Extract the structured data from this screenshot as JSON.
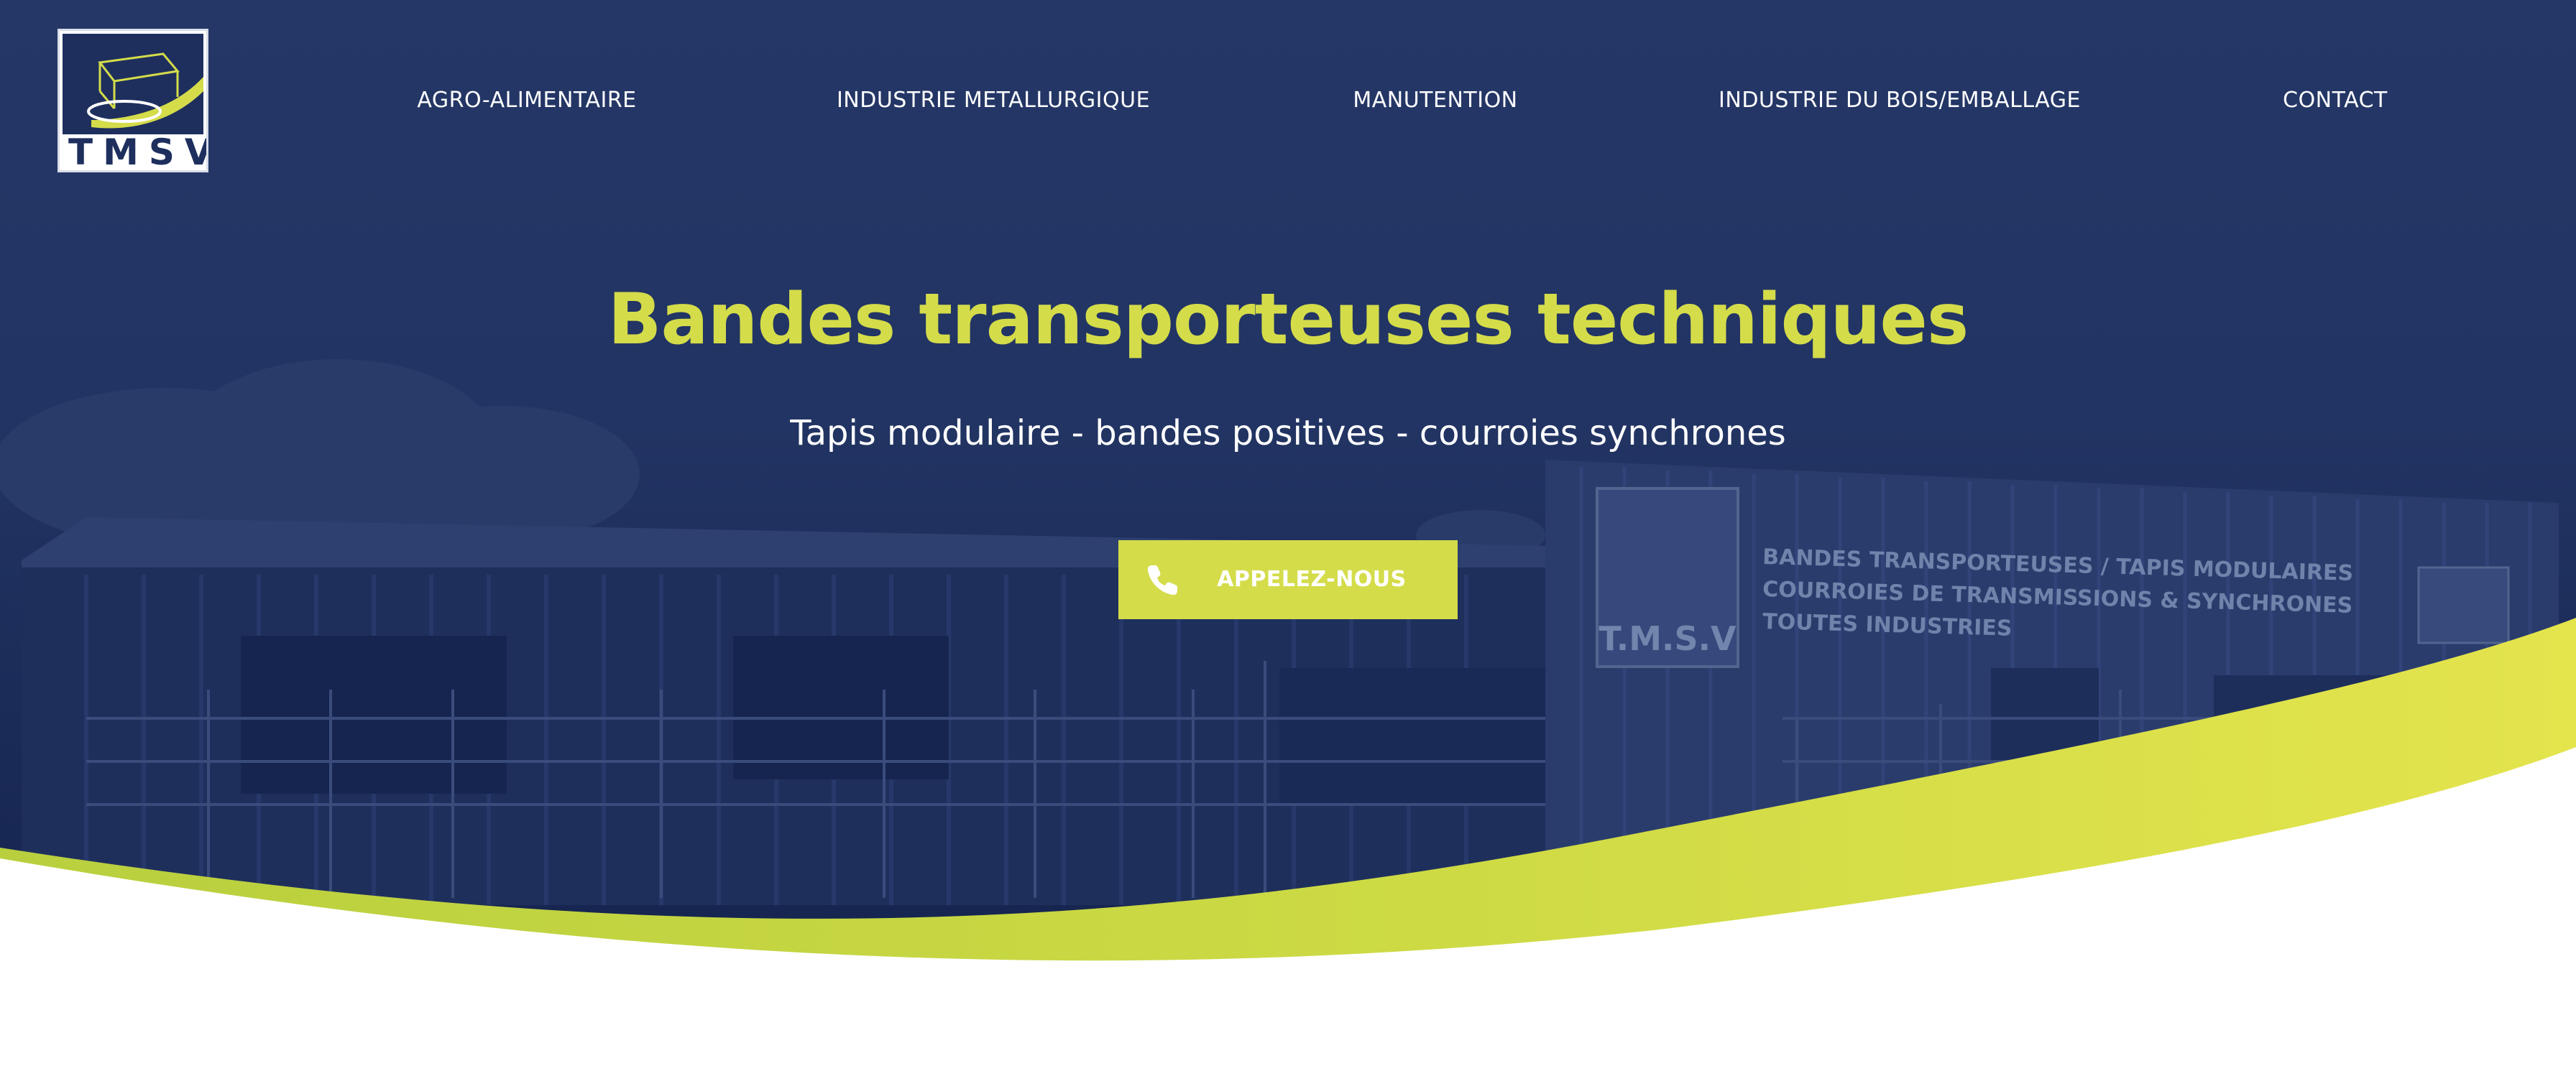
{
  "brand": {
    "logo_text": "TMSV",
    "building_sign": {
      "lines": [
        "BANDES TRANSPORTEUSES / TAPIS MODULAIRES",
        "COURROIES DE TRANSMISSIONS & SYNCHRONES",
        "TOUTES INDUSTRIES"
      ],
      "logo_text": "T.M.S.V"
    }
  },
  "nav": {
    "items": [
      {
        "label": "AGRO-ALIMENTAIRE"
      },
      {
        "label": "INDUSTRIE METALLURGIQUE"
      },
      {
        "label": "MANUTENTION"
      },
      {
        "label": "INDUSTRIE DU BOIS/EMBALLAGE"
      },
      {
        "label": "CONTACT"
      }
    ]
  },
  "hero": {
    "title": "Bandes transporteuses techniques",
    "subtitle": "Tapis modulaire - bandes positives - courroies synchrones",
    "cta_label": "APPELEZ-NOUS"
  },
  "icons": {
    "phone": "phone-icon",
    "logo": "conveyor-truck-logo"
  },
  "colors": {
    "navy": "#243766",
    "accent": "#d4dc4a",
    "accent_dark": "#b9cf3e",
    "text_light": "#ffffff"
  }
}
